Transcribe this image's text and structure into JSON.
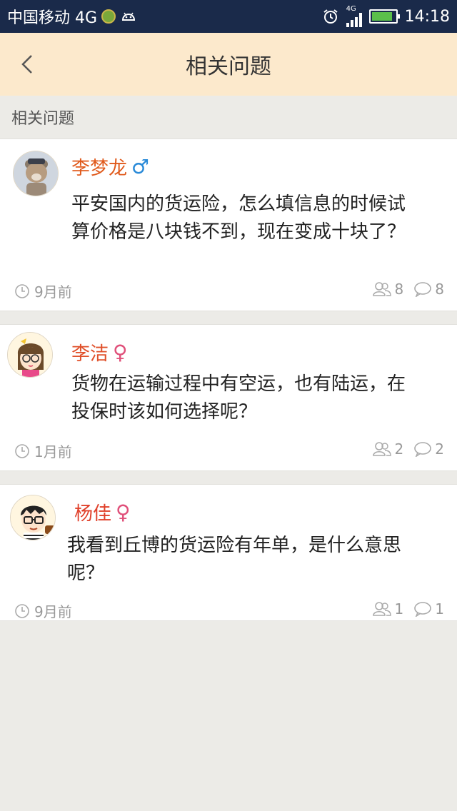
{
  "status_bar": {
    "carrier": "中国移动 4G",
    "network": "4G",
    "time": "14:18"
  },
  "header": {
    "title": "相关问题",
    "back_icon": "chevron-left-icon"
  },
  "section": {
    "label": "相关问题"
  },
  "questions": [
    {
      "user": "李梦龙",
      "gender": "male",
      "gender_symbol": "♂",
      "name_color": "#e05a1c",
      "gender_color": "#2a8ad8",
      "text_lines": [
        "平安国内的货运险，怎么填信息的时候试",
        "算价格是八块钱不到，现在变成十块了？"
      ],
      "time": "9月前",
      "follows": "8",
      "comments": "8"
    },
    {
      "user": "李洁",
      "gender": "female",
      "gender_symbol": "♀",
      "name_color": "#e0502a",
      "gender_color": "#e0507a",
      "text_lines": [
        "货物在运输过程中有空运，也有陆运，在",
        "投保时该如何选择呢？"
      ],
      "time": "1月前",
      "follows": "2",
      "comments": "2"
    },
    {
      "user": "杨佳",
      "gender": "female",
      "gender_symbol": "♀",
      "name_color": "#e0402a",
      "gender_color": "#e0507a",
      "text_lines": [
        "我看到丘博的货运险有年单，是什么意思",
        "呢？"
      ],
      "time": "9月前",
      "follows": "1",
      "comments": "1"
    }
  ]
}
